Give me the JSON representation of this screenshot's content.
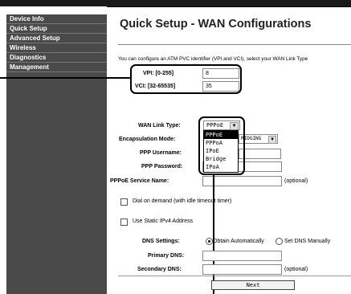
{
  "sidebar": {
    "items": [
      {
        "label": "Device Info"
      },
      {
        "label": "Quick Setup"
      },
      {
        "label": "Advanced Setup"
      },
      {
        "label": "Wireless"
      },
      {
        "label": "Diagnostics"
      },
      {
        "label": "Management"
      }
    ]
  },
  "page": {
    "title": "Quick Setup - WAN Configurations",
    "intro": "You can configure an ATM PVC identifier (VPI and VCI), select your WAN Link Type"
  },
  "pvc": {
    "vpi_label": "VPI: [0-255]",
    "vpi_value": "8",
    "vci_label": "VCI: [32-65535]",
    "vci_value": "35"
  },
  "wan_link": {
    "label": "WAN Link Type:",
    "selected": "PPPoE",
    "options": [
      "PPPoE",
      "PPPoA",
      "IPoE",
      "Bridge",
      "IPoA"
    ]
  },
  "encapsulation": {
    "label": "Encapsulation Mode:",
    "value": "RIDGING"
  },
  "ppp": {
    "username_label": "PPP Username:",
    "password_label": "PPP Password:",
    "service_label": "PPPoE Service Name:",
    "optional": "(optional)"
  },
  "options": {
    "dial_on_demand": "Dial on demand (with idle timeout timer)",
    "static_ipv4": "Use Static IPv4 Address"
  },
  "dns": {
    "settings_label": "DNS Settings:",
    "obtain_auto": "Obtain Automatically",
    "set_manual": "Set DNS Manually",
    "primary_label": "Primary DNS:",
    "secondary_label": "Secondary DNS:",
    "optional": "(optional)"
  },
  "buttons": {
    "next": "Next"
  }
}
